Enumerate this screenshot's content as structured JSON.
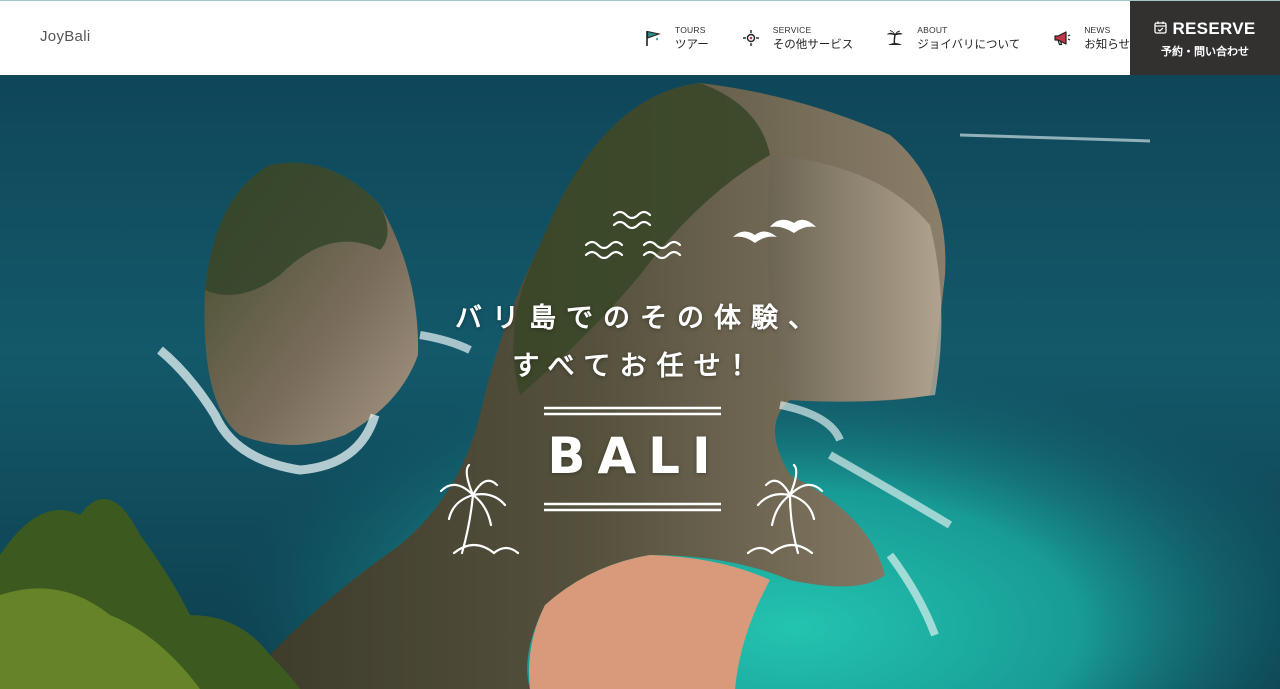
{
  "header": {
    "logo": "JoyBali",
    "nav": [
      {
        "en": "TOURS",
        "jp": "ツアー",
        "icon": "flag-icon"
      },
      {
        "en": "SERVICE",
        "jp": "その他サービス",
        "icon": "compass-icon"
      },
      {
        "en": "ABOUT",
        "jp": "ジョイバリについて",
        "icon": "palm-island-icon"
      },
      {
        "en": "NEWS",
        "jp": "お知らせ",
        "icon": "megaphone-icon"
      }
    ],
    "reserve": {
      "en": "RESERVE",
      "jp": "予約・問い合わせ",
      "icon": "calendar-icon"
    }
  },
  "hero": {
    "catch_line1": "バリ島でのその体験、",
    "catch_line2": "すべてお任せ！",
    "brand": "BALI",
    "decorations": [
      "waves-icon",
      "birds-icon",
      "palm-tree-icon",
      "palm-tree-icon"
    ]
  },
  "colors": {
    "accent_teal": "#2a8c82",
    "accent_red": "#c0374a",
    "reserve_bg": "#333130"
  }
}
